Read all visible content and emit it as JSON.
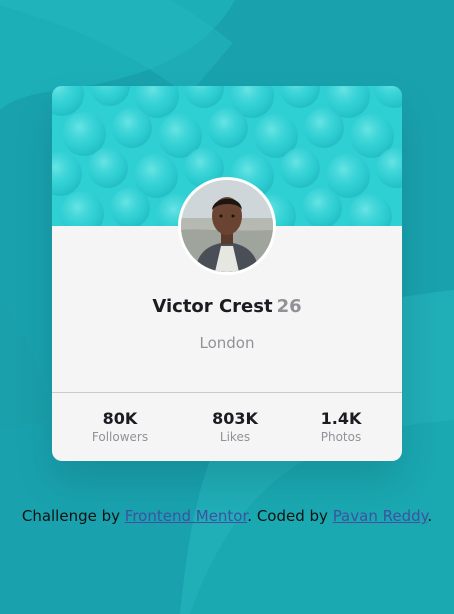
{
  "colors": {
    "background": "#19a2ae",
    "card": "#f5f5f5",
    "header_pattern": "#2fd0d4",
    "name_text": "#1b1c21",
    "muted_text": "#909298",
    "link": "#3e52a3"
  },
  "profile": {
    "name": "Victor Crest",
    "age": "26",
    "location": "London",
    "avatar": "profile-photo"
  },
  "stats": [
    {
      "value": "80K",
      "label": "Followers"
    },
    {
      "value": "803K",
      "label": "Likes"
    },
    {
      "value": "1.4K",
      "label": "Photos"
    }
  ],
  "attribution": {
    "prefix": "Challenge by ",
    "link1": "Frontend Mentor",
    "middle": ". Coded by ",
    "link2": "Pavan Reddy",
    "suffix": "."
  }
}
